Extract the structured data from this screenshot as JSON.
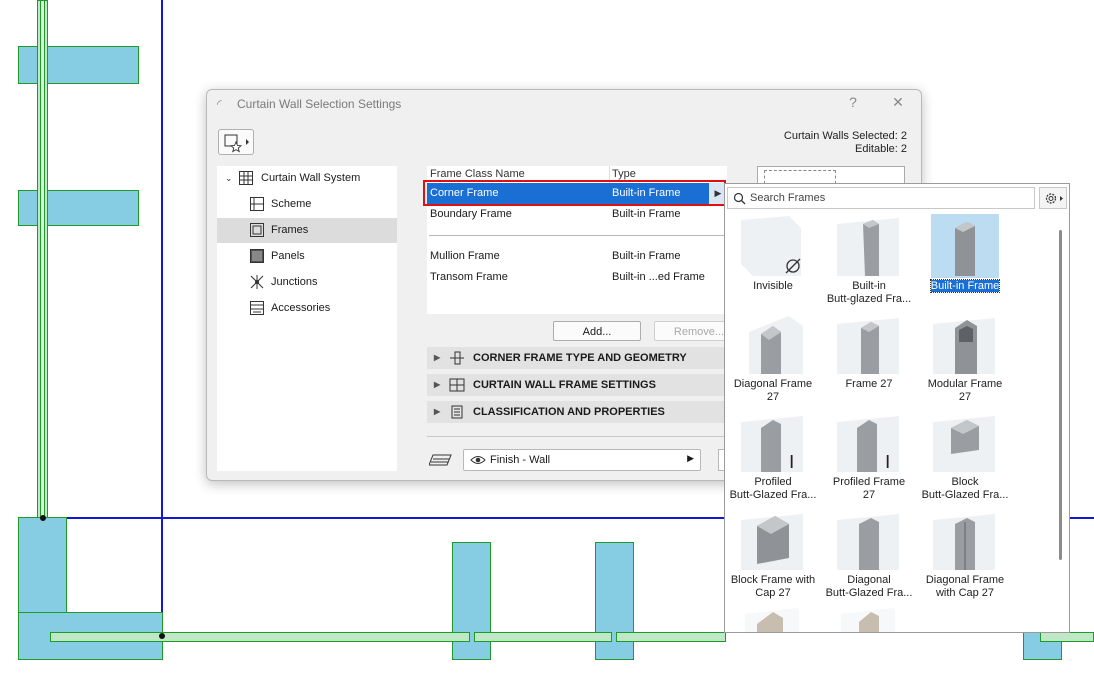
{
  "dialog": {
    "title": "Curtain Wall Selection Settings",
    "help_label": "?",
    "close_label": "✕",
    "selected_line": "Curtain Walls Selected: 2",
    "editable_line": "Editable: 2"
  },
  "tree": {
    "root": "Curtain Wall System",
    "items": [
      {
        "label": "Scheme",
        "icon": "scheme-icon"
      },
      {
        "label": "Frames",
        "icon": "frames-icon",
        "selected": true
      },
      {
        "label": "Panels",
        "icon": "panels-icon"
      },
      {
        "label": "Junctions",
        "icon": "junctions-icon"
      },
      {
        "label": "Accessories",
        "icon": "accessories-icon"
      }
    ]
  },
  "frame_table": {
    "headers": [
      "Frame Class Name",
      "Type"
    ],
    "rows": [
      {
        "name": "Corner Frame",
        "type": "Built-in Frame",
        "selected": true
      },
      {
        "name": "Boundary Frame",
        "type": "Built-in Frame"
      },
      {
        "name": "Mullion Frame",
        "type": "Built-in Frame"
      },
      {
        "name": "Transom Frame",
        "type": "Built-in ...ed Frame"
      }
    ]
  },
  "buttons": {
    "add": "Add...",
    "remove": "Remove..."
  },
  "sections": [
    "CORNER FRAME TYPE AND GEOMETRY",
    "CURTAIN WALL FRAME SETTINGS",
    "CLASSIFICATION AND PROPERTIES"
  ],
  "finish": {
    "value": "Finish - Wall"
  },
  "popup": {
    "search_placeholder": "Search Frames",
    "tiles": [
      {
        "line1": "Invisible",
        "line2": ""
      },
      {
        "line1": "Built-in",
        "line2": "Butt-glazed Fra..."
      },
      {
        "line1": "Built-in Frame",
        "line2": "",
        "selected": true
      },
      {
        "line1": "Diagonal Frame",
        "line2": "27"
      },
      {
        "line1": "Frame 27",
        "line2": ""
      },
      {
        "line1": "Modular Frame",
        "line2": "27"
      },
      {
        "line1": "Profiled",
        "line2": "Butt-Glazed Fra..."
      },
      {
        "line1": "Profiled Frame",
        "line2": "27"
      },
      {
        "line1": "Block",
        "line2": "Butt-Glazed Fra..."
      },
      {
        "line1": "Block Frame with",
        "line2": "Cap 27"
      },
      {
        "line1": "Diagonal",
        "line2": "Butt-Glazed Fra..."
      },
      {
        "line1": "Diagonal Frame",
        "line2": "with Cap 27"
      }
    ]
  },
  "colors": {
    "selection_blue": "#1a6fd4",
    "highlight_red": "#e01010",
    "plan_blue_line": "#1018d8",
    "wall_fill": "#86cde3",
    "wall_outline": "#1f9a2a"
  }
}
